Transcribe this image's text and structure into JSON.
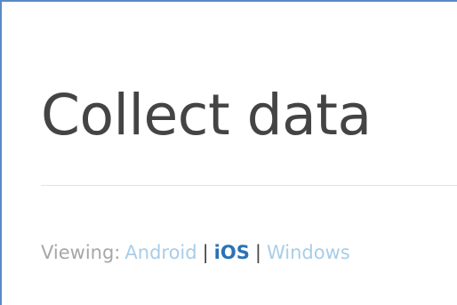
{
  "page": {
    "title": "Collect data"
  },
  "platform_selector": {
    "label": "Viewing:",
    "separator": "|",
    "options": [
      {
        "label": "Android",
        "selected": false
      },
      {
        "label": "iOS",
        "selected": true
      },
      {
        "label": "Windows",
        "selected": false
      }
    ]
  },
  "colors": {
    "frame_border": "#5b8ac4",
    "title_text": "#444444",
    "link_inactive": "#a8cde8",
    "link_active": "#2a72b5",
    "label_text": "#a7a7a7"
  }
}
